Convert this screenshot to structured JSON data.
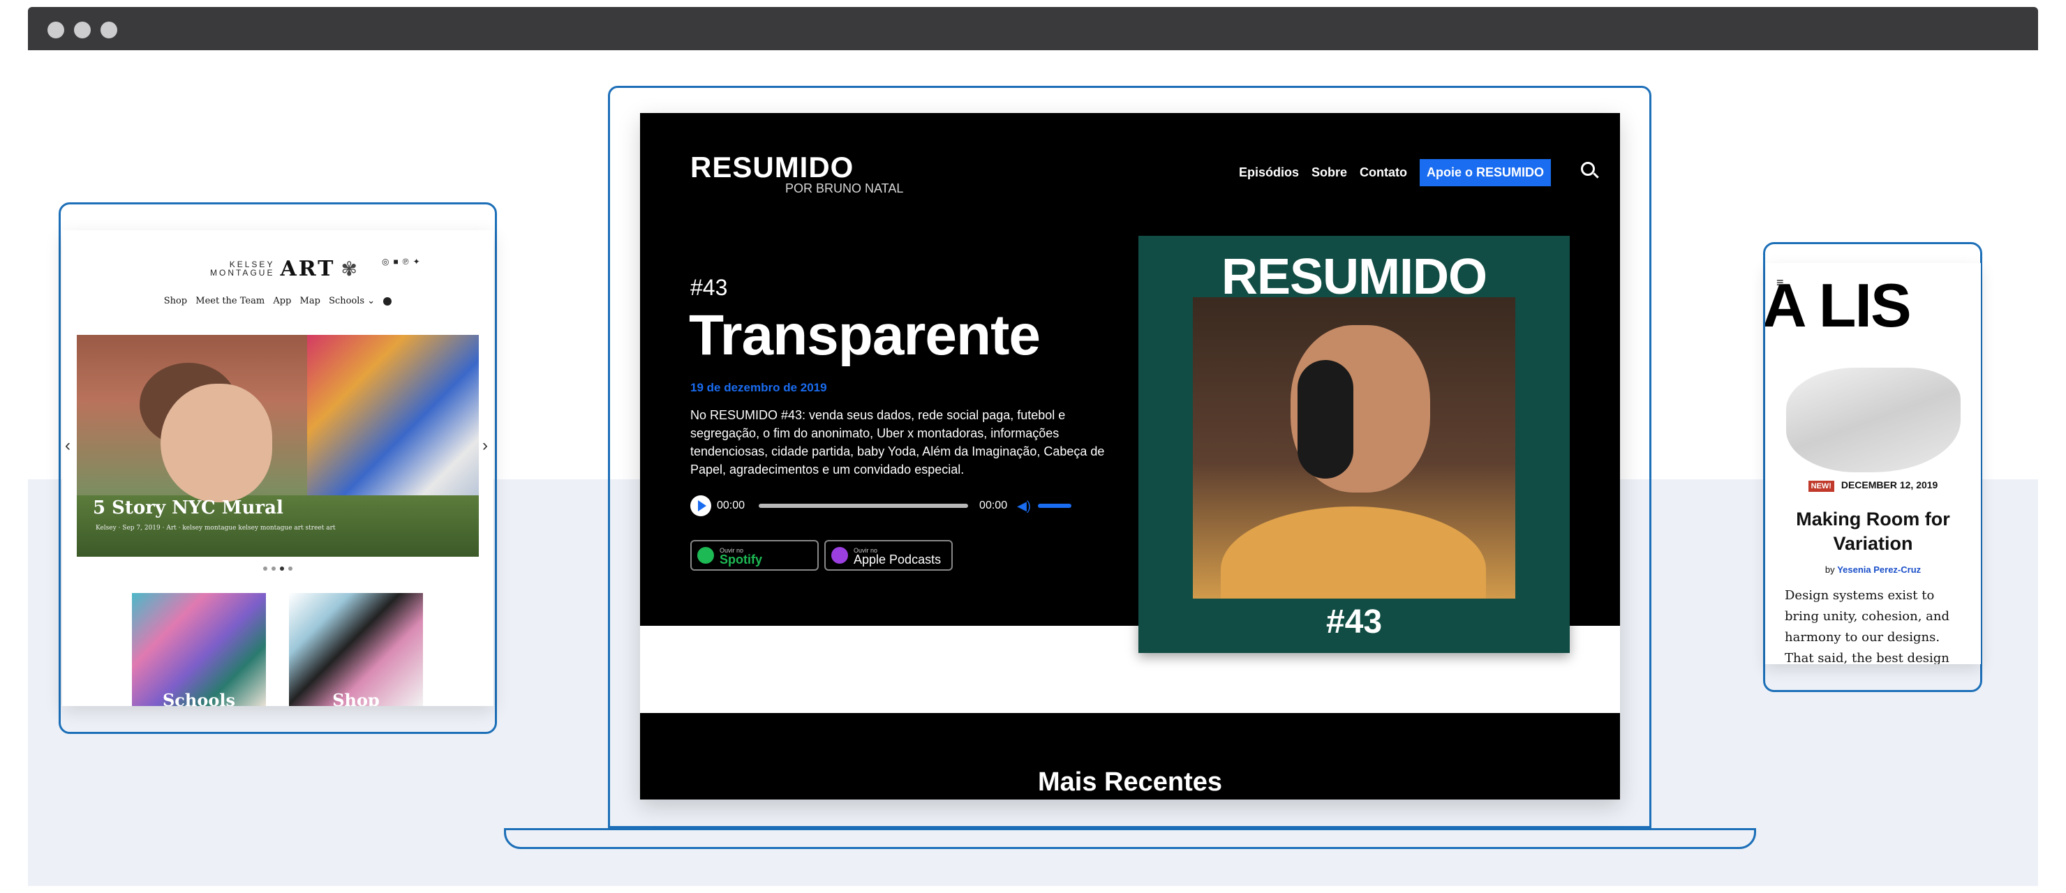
{
  "tablet": {
    "logo_small": "KELSEY MONTAGUE",
    "logo_big": "ART",
    "social_icons": [
      "instagram-icon",
      "facebook-icon",
      "pinterest-icon",
      "twitter-icon"
    ],
    "nav": [
      "Shop",
      "Meet the Team",
      "App",
      "Map",
      "Schools ⌄"
    ],
    "hero_title": "5 Story NYC Mural",
    "hero_meta": "Kelsey · Sep 7, 2019 · Art · kelsey montague kelsey montague art street art",
    "thumbs": [
      "Schools",
      "Shop"
    ]
  },
  "laptop": {
    "logo": "RESUMIDO",
    "logo_sub": "POR BRUNO NATAL",
    "nav": [
      "Episódios",
      "Sobre",
      "Contato"
    ],
    "cta": "Apoie o RESUMIDO",
    "episode_number": "#43",
    "episode_title": "Transparente",
    "episode_date": "19 de dezembro de 2019",
    "episode_desc": "No RESUMIDO #43: venda seus dados, rede social paga, futebol e segregação, o fim do anonimato, Uber x montadoras, informações tendenciosas, cidade partida, baby Yoda, Além da Imaginação, Cabeça de Papel, agradecimentos e um convidado especial.",
    "player_time_current": "00:00",
    "player_time_total": "00:00",
    "badge_spotify_small": "Ouvir no",
    "badge_spotify_big": "Spotify",
    "badge_apple_small": "Ouvir no",
    "badge_apple_big": "Apple Podcasts",
    "cover_logo": "RESUMIDO",
    "cover_number": "#43",
    "section_title": "Mais Recentes",
    "accent_color": "#1a6cf0",
    "cover_color": "#114d44"
  },
  "phone": {
    "menu_icon": "hamburger-icon",
    "big_text": "A LIS",
    "badge": "NEW!",
    "date": "DECEMBER 12, 2019",
    "title": "Making Room for Variation",
    "by_prefix": "by",
    "author": "Yesenia Perez-Cruz",
    "body": "Design systems exist to bring unity, cohesion, and harmony to our designs. That said, the best design"
  }
}
